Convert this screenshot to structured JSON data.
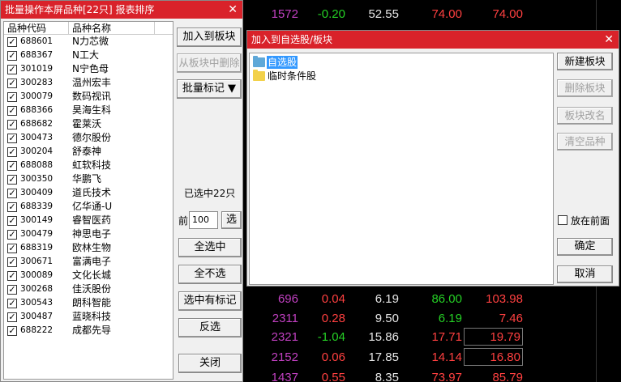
{
  "background_quotes": [
    {
      "c1": "1572",
      "c2": "-0.20",
      "c3": "52.55",
      "c4": "74.00",
      "c5": "74.00",
      "s2": "neg",
      "s4": "pos",
      "s5": "pos",
      "b5": false
    },
    {
      "c1": "696",
      "c2": "0.04",
      "c3": "6.19",
      "c4": "86.00",
      "c5": "103.98",
      "s2": "pos",
      "s4": "neg",
      "s5": "pos",
      "b5": false
    },
    {
      "c1": "2311",
      "c2": "0.28",
      "c3": "9.50",
      "c4": "6.19",
      "c5": "7.46",
      "s2": "pos",
      "s4": "neg",
      "s5": "pos",
      "b5": false
    },
    {
      "c1": "2321",
      "c2": "-1.04",
      "c3": "15.86",
      "c4": "17.71",
      "c5": "19.79",
      "s2": "neg",
      "s4": "pos",
      "s5": "pos",
      "b5": true
    },
    {
      "c1": "2152",
      "c2": "0.06",
      "c3": "17.85",
      "c4": "14.14",
      "c5": "16.80",
      "s2": "pos",
      "s4": "pos",
      "s5": "pos",
      "b5": true
    },
    {
      "c1": "1437",
      "c2": "0.55",
      "c3": "8.35",
      "c4": "73.97",
      "c5": "85.79",
      "s2": "pos",
      "s4": "pos",
      "s5": "pos",
      "b5": false
    }
  ],
  "batch_dialog": {
    "title": "批量操作本屏品种[22只] 报表排序",
    "close": "✕",
    "col_code": "品种代码",
    "col_name": "品种名称",
    "items": [
      {
        "code": "688601",
        "name": "N力芯微"
      },
      {
        "code": "688367",
        "name": "N工大"
      },
      {
        "code": "301019",
        "name": "N宁色母"
      },
      {
        "code": "300283",
        "name": "温州宏丰"
      },
      {
        "code": "300079",
        "name": "数码视讯"
      },
      {
        "code": "688366",
        "name": "昊海生科"
      },
      {
        "code": "688682",
        "name": "霍莱沃"
      },
      {
        "code": "300473",
        "name": "德尔股份"
      },
      {
        "code": "300204",
        "name": "舒泰神"
      },
      {
        "code": "688088",
        "name": "虹软科技"
      },
      {
        "code": "300350",
        "name": "华鹏飞"
      },
      {
        "code": "300409",
        "name": "道氏技术"
      },
      {
        "code": "688339",
        "name": "亿华通-U"
      },
      {
        "code": "300149",
        "name": "睿智医药"
      },
      {
        "code": "300479",
        "name": "神思电子"
      },
      {
        "code": "688319",
        "name": "欧林生物"
      },
      {
        "code": "300671",
        "name": "富满电子"
      },
      {
        "code": "300089",
        "name": "文化长城"
      },
      {
        "code": "300268",
        "name": "佳沃股份"
      },
      {
        "code": "300543",
        "name": "朗科智能"
      },
      {
        "code": "300487",
        "name": "蓝晓科技"
      },
      {
        "code": "688222",
        "name": "成都先导"
      }
    ],
    "btn_add": "加入到板块",
    "btn_remove": "从板块中删除",
    "btn_batch_mark": "批量标记 ▼",
    "selected_text": "已选中22只",
    "front_label": "前",
    "front_value": "100",
    "btn_pick": "选",
    "btn_select_all": "全选中",
    "btn_select_none": "全不选",
    "btn_select_marked": "选中有标记",
    "btn_invert": "反选",
    "btn_close": "关闭"
  },
  "add_dialog": {
    "title": "加入到自选股/板块",
    "close": "✕",
    "tree": [
      {
        "label": "自选股",
        "selected": true,
        "color": "#5fa8d8"
      },
      {
        "label": "临时条件股",
        "selected": false,
        "color": "#f2d14a"
      }
    ],
    "btn_new": "新建板块",
    "btn_delete": "删除板块",
    "btn_rename": "板块改名",
    "btn_clear": "清空品种",
    "front_checkbox_label": "放在前面",
    "btn_ok": "确定",
    "btn_cancel": "取消"
  }
}
